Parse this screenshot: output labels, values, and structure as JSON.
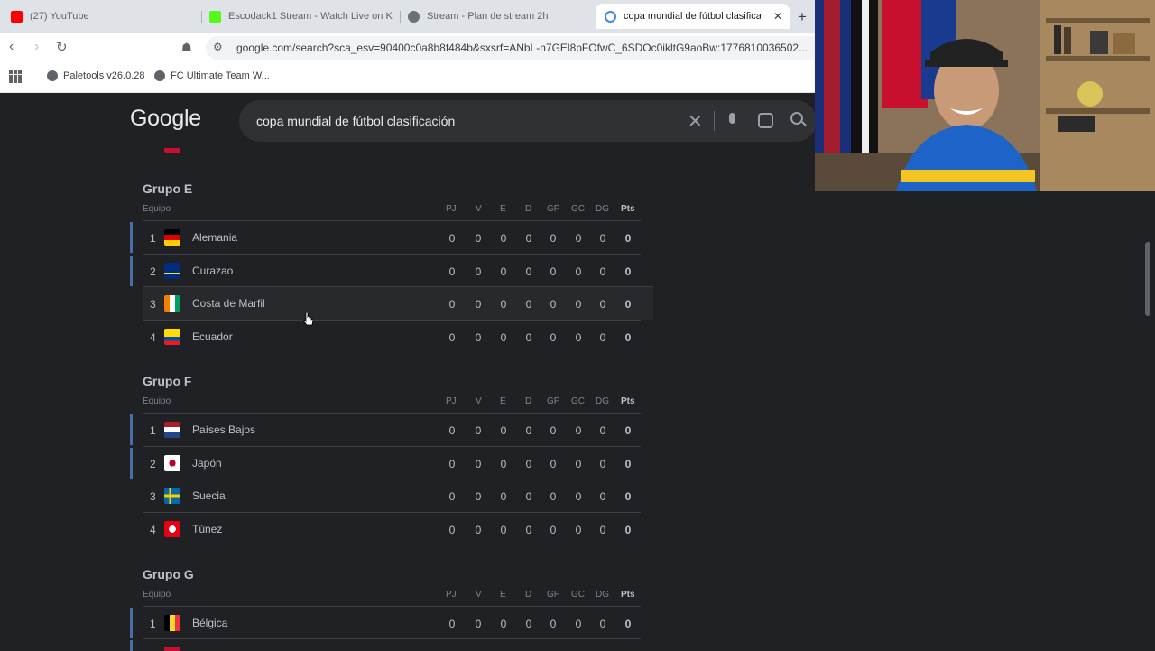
{
  "browser": {
    "tabs": [
      {
        "label": "(27) YouTube",
        "icon": "youtube-icon",
        "color": "#ff0000",
        "active": false
      },
      {
        "label": "Escodack1 Stream - Watch Live on K",
        "icon": "kick-icon",
        "color": "#53fc18",
        "active": false
      },
      {
        "label": "Stream - Plan de stream 2h",
        "icon": "openai-icon",
        "color": "#5f6368",
        "active": false
      },
      {
        "label": "copa mundial de fútbol clasificac",
        "icon": "google-icon",
        "color": "#4285f4",
        "active": true
      }
    ],
    "new_tab": "+",
    "url": "google.com/search?sca_esv=90400c0a8b8f484b&sxsrf=ANbL-n7GEl8pFOfwC_6SDOc0ikltG9aoBw:1776810036502...",
    "bookmarks": [
      "Paletools v26.0.28",
      "FC Ultimate Team W..."
    ]
  },
  "search": {
    "logo": "Google",
    "query": "copa mundial de fútbol clasificación"
  },
  "table_headers": {
    "team": "Equipo",
    "cols": [
      "PJ",
      "V",
      "E",
      "D",
      "GF",
      "GC",
      "DG",
      "Pts"
    ]
  },
  "groups": [
    {
      "title": "Grupo E",
      "rows": [
        {
          "pos": "1",
          "team": "Alemania",
          "flag": "germany",
          "stats": [
            "0",
            "0",
            "0",
            "0",
            "0",
            "0",
            "0",
            "0"
          ]
        },
        {
          "pos": "2",
          "team": "Curazao",
          "flag": "curacao",
          "stats": [
            "0",
            "0",
            "0",
            "0",
            "0",
            "0",
            "0",
            "0"
          ]
        },
        {
          "pos": "3",
          "team": "Costa de Marfil",
          "flag": "ivory-coast",
          "stats": [
            "0",
            "0",
            "0",
            "0",
            "0",
            "0",
            "0",
            "0"
          ]
        },
        {
          "pos": "4",
          "team": "Ecuador",
          "flag": "ecuador",
          "stats": [
            "0",
            "0",
            "0",
            "0",
            "0",
            "0",
            "0",
            "0"
          ]
        }
      ]
    },
    {
      "title": "Grupo F",
      "rows": [
        {
          "pos": "1",
          "team": "Países Bajos",
          "flag": "netherlands",
          "stats": [
            "0",
            "0",
            "0",
            "0",
            "0",
            "0",
            "0",
            "0"
          ]
        },
        {
          "pos": "2",
          "team": "Japón",
          "flag": "japan",
          "stats": [
            "0",
            "0",
            "0",
            "0",
            "0",
            "0",
            "0",
            "0"
          ]
        },
        {
          "pos": "3",
          "team": "Suecia",
          "flag": "sweden",
          "stats": [
            "0",
            "0",
            "0",
            "0",
            "0",
            "0",
            "0",
            "0"
          ]
        },
        {
          "pos": "4",
          "team": "Túnez",
          "flag": "tunisia",
          "stats": [
            "0",
            "0",
            "0",
            "0",
            "0",
            "0",
            "0",
            "0"
          ]
        }
      ]
    },
    {
      "title": "Grupo G",
      "rows": [
        {
          "pos": "1",
          "team": "Bélgica",
          "flag": "belgium",
          "stats": [
            "0",
            "0",
            "0",
            "0",
            "0",
            "0",
            "0",
            "0"
          ]
        }
      ]
    }
  ]
}
